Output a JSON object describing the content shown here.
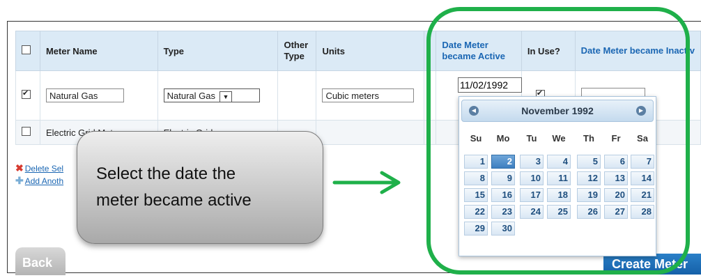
{
  "table": {
    "headers": {
      "meter_name": "Meter Name",
      "type": "Type",
      "other_type": "Other Type",
      "units": "Units",
      "date_active": "Date Meter became Active",
      "in_use": "In Use?",
      "date_inactive": "Date Meter became Inactiv"
    },
    "row1": {
      "meter_name": "Natural Gas",
      "type": "Natural Gas",
      "units": "Cubic meters",
      "date_active": "11/02/1992"
    },
    "row2": {
      "meter_name": "Electric Grid Met",
      "type": "Electric Grid"
    }
  },
  "links": {
    "delete": "Delete Sel",
    "add": "Add Anoth"
  },
  "buttons": {
    "back": "Back",
    "create": "Create Meter"
  },
  "callout": {
    "line1": "Select the date the",
    "line2": "meter became active"
  },
  "calendar": {
    "month_title": "November 1992",
    "weekdays": [
      "Su",
      "Mo",
      "Tu",
      "We",
      "Th",
      "Fr",
      "Sa"
    ],
    "days": [
      "1",
      "2",
      "3",
      "4",
      "5",
      "6",
      "7",
      "8",
      "9",
      "10",
      "11",
      "12",
      "13",
      "14",
      "15",
      "16",
      "17",
      "18",
      "19",
      "20",
      "21",
      "22",
      "23",
      "24",
      "25",
      "26",
      "27",
      "28",
      "29",
      "30"
    ],
    "selected_day": "2"
  },
  "colors": {
    "highlight_ring": "#1fb04a",
    "header_bg": "#dbeaf6",
    "link": "#1a66b3",
    "selected_day": "#3d7fc0"
  }
}
